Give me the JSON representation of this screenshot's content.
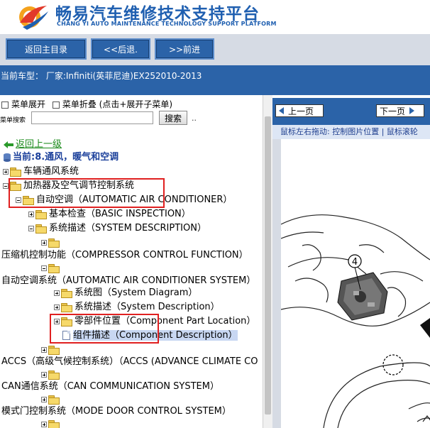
{
  "header": {
    "title_cn": "畅易汽车维修技术支持平台",
    "title_en": "CHANG YI AUTO MAINTENANCE TECHNOLOGY SUPPORT PLATFORM"
  },
  "nav": {
    "home_label": "返回主目录",
    "back_label": "<<后退.",
    "forward_label": ">>前进"
  },
  "car": {
    "label": "当前车型：  厂家:Infiniti(英菲尼迪)EX252010-2013"
  },
  "tree_toolbar": {
    "expand_label": "菜单展开",
    "collapse_label": "菜单折叠 (点击+展开子菜单)",
    "search_label": "菜单搜索",
    "search_value": "",
    "search_button": "搜索",
    "dots": ".."
  },
  "tree": {
    "back_link": "返回上一级",
    "current": "当前:8.通风，暖气和空调",
    "items": [
      "车辆通风系统",
      "加热器及空气调节控制系统",
      "自动空调（AUTOMATIC AIR CONDITIONER）",
      "基本检查（BASIC INSPECTION）",
      "系统描述（SYSTEM DESCRIPTION）",
      "压缩机控制功能（COMPRESSOR CONTROL FUNCTION）",
      "自动空调系统（AUTOMATIC AIR CONDITIONER SYSTEM）",
      "系统图（System Diagram）",
      "系统描述（System Description）",
      "零部件位置（Component Part Location）",
      "组件描述（Component Description）",
      "ACCS（高级气候控制系统）（ACCS (ADVANCE CLIMATE CO",
      "CAN通信系统（CAN COMMUNICATION SYSTEM）",
      "模式门控制系统（MODE DOOR CONTROL SYSTEM）"
    ]
  },
  "viewer": {
    "prev_label": "上一页",
    "next_label": "下一页",
    "hint": "鼠标左右拖动: 控制图片位置 | 鼠标滚轮",
    "callout": "4"
  },
  "colors": {
    "brand_blue": "#2b63a8",
    "title_blue": "#1f5fb0",
    "highlight": "#c8d7f2",
    "annotation_red": "#e02020",
    "link_green": "#1a8a1a"
  }
}
